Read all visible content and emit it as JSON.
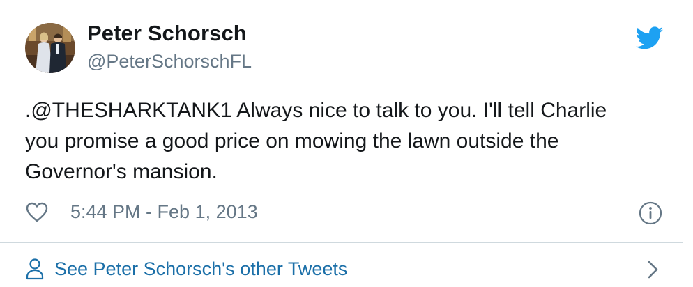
{
  "tweet": {
    "author": {
      "display_name": "Peter Schorsch",
      "handle": "@PeterSchorschFL"
    },
    "text": ".@THESHARKTANK1 Always nice to talk to you. I'll tell Charlie\nyou promise a good price on mowing the lawn outside the\nGovernor's mansion.",
    "timestamp": "5:44 PM - Feb 1, 2013"
  },
  "footer": {
    "link_label": "See Peter Schorsch's other Tweets"
  },
  "icons": {
    "brand": "twitter-bird-icon",
    "like": "heart-icon",
    "info": "info-icon",
    "profile": "person-icon",
    "more": "chevron-right-icon"
  },
  "colors": {
    "brand_blue": "#1da1f2",
    "link_blue": "#1b6fa8",
    "secondary_text": "#657786",
    "primary_text": "#14171a",
    "divider": "#cfd9de"
  }
}
